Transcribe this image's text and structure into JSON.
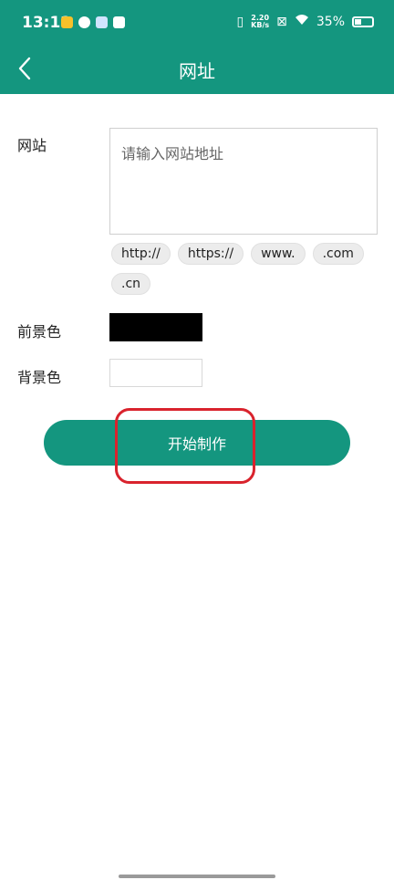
{
  "status_bar": {
    "time": "13:12",
    "speed_top": "2.20",
    "speed_bottom": "KB/s",
    "battery": "35%"
  },
  "header": {
    "title": "网址"
  },
  "form": {
    "website_label": "网站",
    "website_placeholder": "请输入网站地址",
    "chips": [
      "http://",
      "https://",
      "www.",
      ".com",
      ".cn"
    ],
    "foreground_label": "前景色",
    "foreground_color": "#000000",
    "background_label": "背景色",
    "background_color": "#ffffff"
  },
  "actions": {
    "start_label": "开始制作"
  },
  "colors": {
    "accent": "#14967f",
    "highlight": "#d9232d"
  }
}
